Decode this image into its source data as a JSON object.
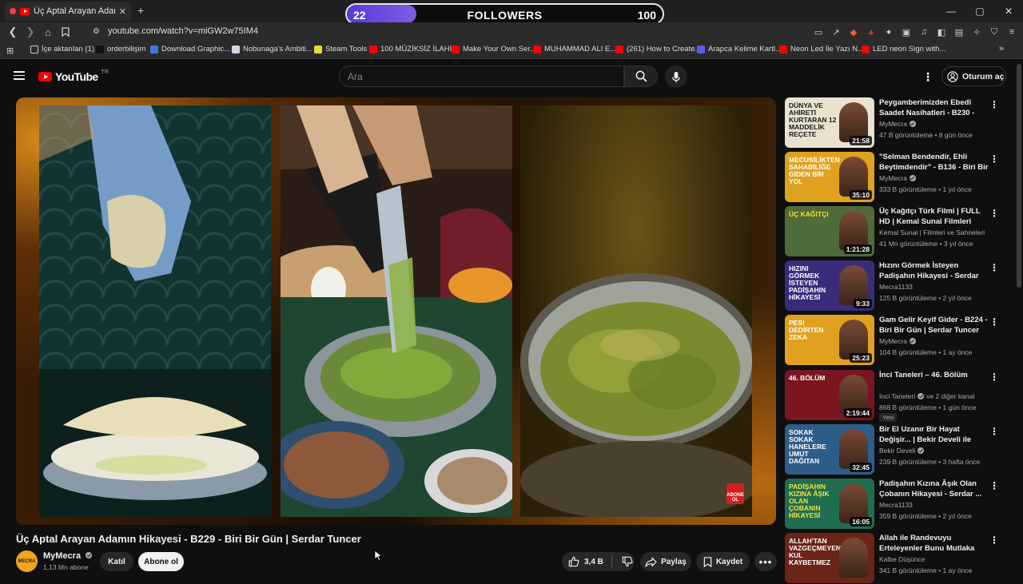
{
  "browser": {
    "tab_title": "Üç Aptal Arayan Adamın Hikâ",
    "new_tab": "+",
    "url": "youtube.com/watch?v=miGW2w75IM4",
    "window_controls": [
      "—",
      "▢",
      "✕"
    ]
  },
  "overlay": {
    "label": "FOLLOWERS",
    "current": "22",
    "target": "100",
    "progress": 0.22,
    "fill_color": "#7b5ce6"
  },
  "bookmarks": [
    {
      "label": "İçe aktarılan (1)",
      "color": "#888888"
    },
    {
      "label": "orderbilişim",
      "color": "#111111"
    },
    {
      "label": "Download Graphic...",
      "color": "#3f7ad8"
    },
    {
      "label": "Nobunaga's Ambiti...",
      "color": "#cfd8e3"
    },
    {
      "label": "Steam Tools",
      "color": "#f0d73a"
    },
    {
      "label": "100 MÜZİKSİZ İLAHİ...",
      "color": "#ff0000"
    },
    {
      "label": "Make Your Own Ser...",
      "color": "#ff0000"
    },
    {
      "label": "MUHAMMAD ALI E...",
      "color": "#ff0000"
    },
    {
      "label": "(261) How to Create...",
      "color": "#ff0000"
    },
    {
      "label": "Arapca Kelime Kartl...",
      "color": "#5b5bf0"
    },
    {
      "label": "Neon Led İle Yazı N...",
      "color": "#ff0000"
    },
    {
      "label": "LED neon Sign with...",
      "color": "#ff0000"
    }
  ],
  "youtube": {
    "logo": "YouTube",
    "region": "TR",
    "search_placeholder": "Ara",
    "signin": "Oturum aç"
  },
  "video": {
    "title": "Üç Aptal Arayan Adamın Hikayesi - B229 - Biri Bir Gün | Serdar Tuncer",
    "channel": "MyMecra",
    "channel_avatar": "MECRA",
    "subscribers": "1,13 Mn abone",
    "join": "Katıl",
    "subscribe": "Abone ol",
    "likes": "3,4 B",
    "share": "Paylaş",
    "save": "Kaydet",
    "corner_badge": "ABONE OL"
  },
  "recommendations": [
    {
      "title": "Peygamberimizden Ebedî Saadet Nasihatleri - B230 - Biri...",
      "channel": "MyMecra",
      "verified": true,
      "meta": "47 B görüntüleme • 8 gün önce",
      "duration": "21:58",
      "thumb_text": "DÜNYA VE AHİRETİ KURTARAN 12 MADDELİK REÇETE",
      "thumb_bg": "#e9e2cf",
      "thumb_fg": "#1b1b1b"
    },
    {
      "title": "\"Selman Bendendir, Ehli Beytimdendir\" - B136 - Biri Bir ...",
      "channel": "MyMecra",
      "verified": true,
      "meta": "333 B görüntüleme • 1 yıl önce",
      "duration": "35:10",
      "thumb_text": "MECUSİLİKTEN SAHABİLİĞE GİDEN BİR YOL",
      "thumb_bg": "#e0a11e",
      "thumb_fg": "#ffffff"
    },
    {
      "title": "Üç Kağıtçı Türk Filmi | FULL HD | Kemal Sunal Filmleri",
      "channel": "Kemal Sunal | Filmleri ve Sahneleri",
      "verified": false,
      "meta": "41 Mn görüntüleme • 3 yıl önce",
      "duration": "1:21:28",
      "thumb_text": "ÜÇ KAĞITÇI",
      "thumb_bg": "#4f6b3a",
      "thumb_fg": "#f5e23a"
    },
    {
      "title": "Hızını Görmek İsteyen Padişahın Hikayesi - Serdar Tuncer",
      "channel": "Mecra1133",
      "verified": false,
      "meta": "125 B görüntüleme • 2 yıl önce",
      "duration": "9:33",
      "thumb_text": "HIZINI GÖRMEK İSTEYEN PADİŞAHIN HİKAYESİ",
      "thumb_bg": "#3a2c7a",
      "thumb_fg": "#ffffff"
    },
    {
      "title": "Gam Gelir Keyif Gider - B224 - Biri Bir Gün | Serdar Tuncer",
      "channel": "MyMecra",
      "verified": true,
      "meta": "104 B görüntüleme • 1 ay önce",
      "duration": "25:23",
      "thumb_text": "PES! DEDİRTEN ZEKA",
      "thumb_bg": "#e0a11e",
      "thumb_fg": "#ffffff"
    },
    {
      "title": "İnci Taneleri – 46. Bölüm",
      "channel": "İnci Taneleri",
      "channel_extra": "ve 2 diğer kanal",
      "verified": true,
      "meta": "868 B görüntüleme • 1 gün önce",
      "badge": "Yeni",
      "duration": "2:19:44",
      "thumb_text": "46. BÖLÜM",
      "thumb_bg": "#7a1620",
      "thumb_fg": "#ffffff"
    },
    {
      "title": "Bir El Uzanır Bir Hayat Değişir... | Bekir Develi ile Peynir Gemisi |...",
      "channel": "Bekir Develi",
      "verified": true,
      "meta": "239 B görüntüleme • 3 hafta önce",
      "duration": "32:45",
      "thumb_text": "SOKAK SOKAK HANELERE UMUT DAĞITAN",
      "thumb_bg": "#2f5d8a",
      "thumb_fg": "#ffffff"
    },
    {
      "title": "Padişahın Kızına Âşık Olan Çobanın Hikayesi - Serdar ...",
      "channel": "Mecra1133",
      "verified": false,
      "meta": "359 B görüntüleme • 2 yıl önce",
      "duration": "16:05",
      "thumb_text": "PADİŞAHIN KIZINA ÂŞIK OLAN ÇOBANIN HİKAYESİ",
      "thumb_bg": "#1f6e52",
      "thumb_fg": "#f5e23a"
    },
    {
      "title": "Allah ile Randevuyu Erteleyenler Bunu Mutlaka Dinlemeli | Öme...",
      "channel": "Kalbe Düşünce",
      "verified": false,
      "meta": "341 B görüntüleme • 1 ay önce",
      "duration": "",
      "thumb_text": "ALLAH'TAN VAZGEÇMEYEN KUL KAYBETMEZ",
      "thumb_bg": "#6b2418",
      "thumb_fg": "#ffffff"
    }
  ]
}
